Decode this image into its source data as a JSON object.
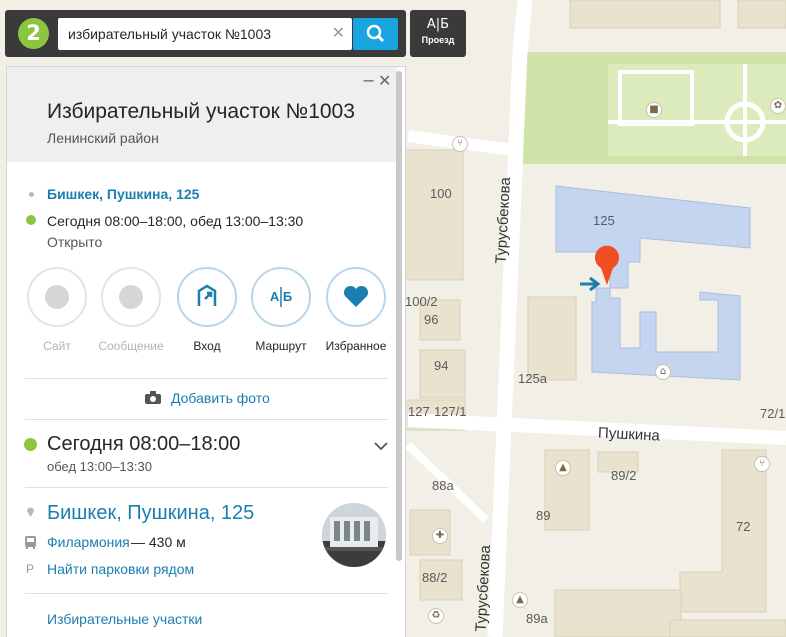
{
  "search": {
    "query": "избирательный участок №1003",
    "clear_glyph": "✕"
  },
  "logo": {
    "glyph": "2"
  },
  "route_button": {
    "glyph": "А|Б",
    "label": "Проезд"
  },
  "map": {
    "streets": [
      "Турусбекова",
      "Турусбекова",
      "Пушкина"
    ],
    "house_numbers": [
      "100",
      "125",
      "100/2",
      "96",
      "94",
      "125а",
      "127",
      "127/1",
      "72/1",
      "88а",
      "89/2",
      "89",
      "72",
      "88/2",
      "89а"
    ],
    "colors": {
      "water_land": "#f2efe6",
      "park": "#cfe3a8",
      "building": "#e8e2cf",
      "target_building": "#c5d4ef",
      "road": "#ffffff",
      "marker": "#f04e23",
      "entrance_arrow": "#1a7fb0"
    }
  },
  "card": {
    "title": "Избирательный участок №1003",
    "subtitle": "Ленинский район",
    "minimize_glyph": "−",
    "close_glyph": "✕",
    "address": "Бишкек, Пушкина, 125",
    "hours": "Сегодня 08:00–18:00, обед 13:00–13:30",
    "status": "Открыто",
    "actions": [
      {
        "label": "Сайт",
        "icon": "globe-icon",
        "enabled": false
      },
      {
        "label": "Сообщение",
        "icon": "message-icon",
        "enabled": false
      },
      {
        "label": "Вход",
        "icon": "entrance-icon",
        "enabled": true
      },
      {
        "label": "Маршрут",
        "icon": "route-icon",
        "enabled": true
      },
      {
        "label": "Избранное",
        "icon": "heart-icon",
        "enabled": true
      }
    ],
    "add_photo": "Добавить фото",
    "big_hours": "Сегодня 08:00–18:00",
    "lunch": "обед 13:00–13:30",
    "big_address": "Бишкек, Пушкина, 125",
    "nearest_stop": "Филармония",
    "stop_distance": "— 430 м",
    "parking_glyph": "P",
    "parking": "Найти парковки рядом",
    "rubric": "Избирательные участки"
  }
}
